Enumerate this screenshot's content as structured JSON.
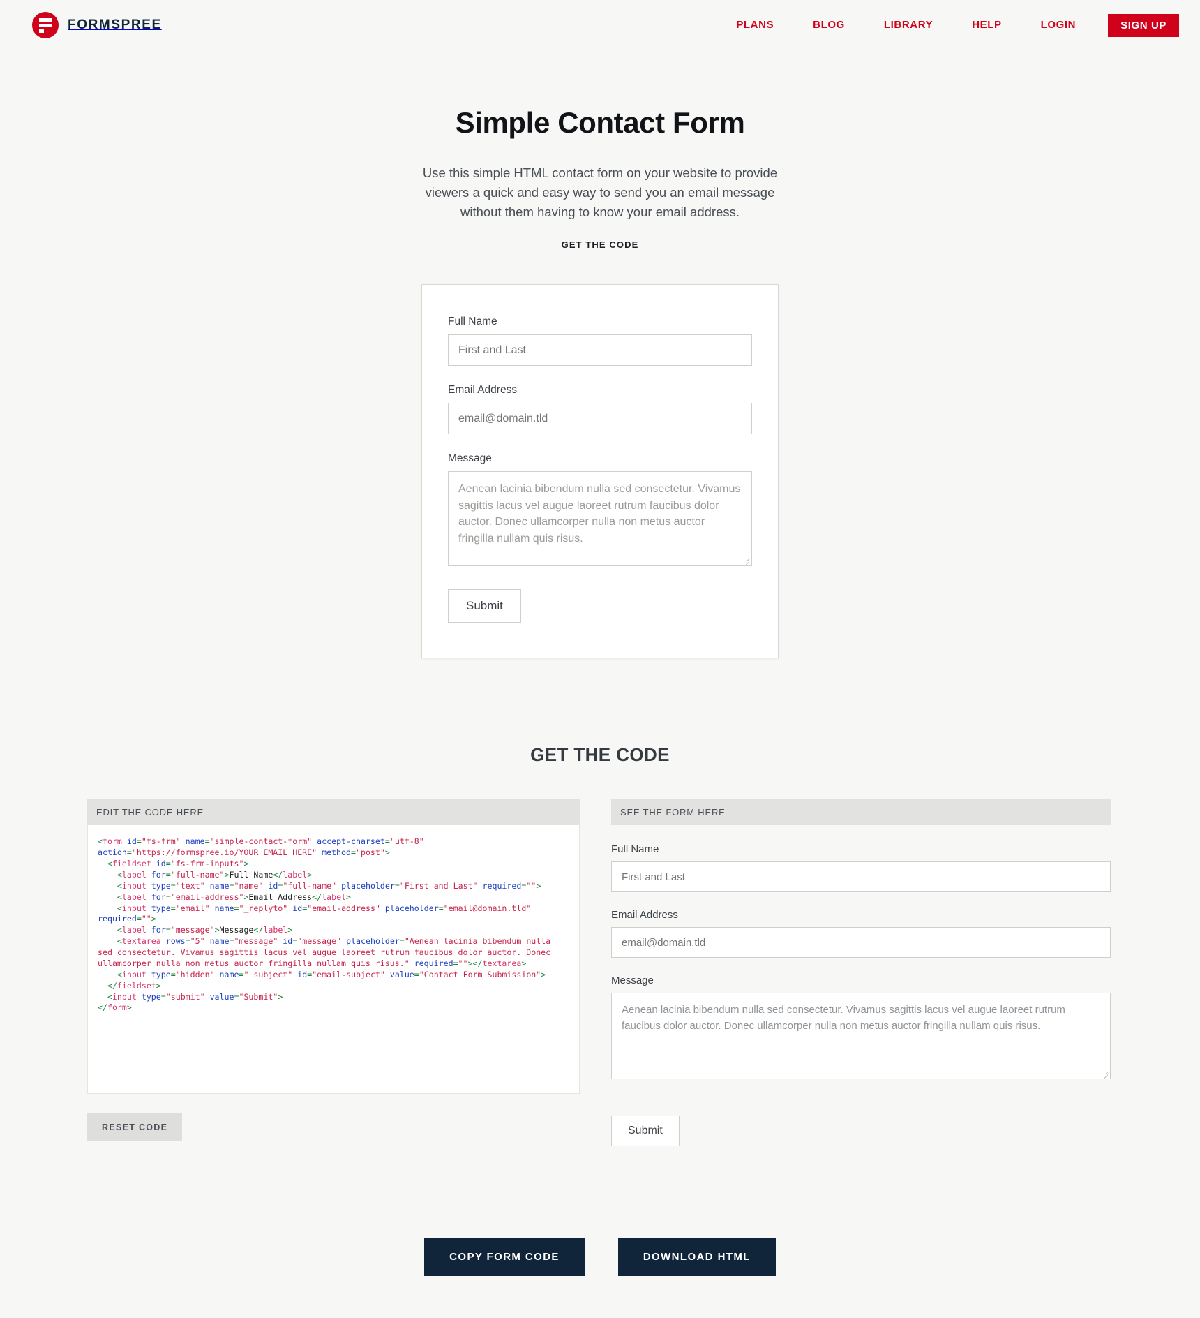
{
  "header": {
    "brand_name": "FORMSPREE",
    "nav": [
      {
        "label": "PLANS"
      },
      {
        "label": "BLOG"
      },
      {
        "label": "LIBRARY"
      },
      {
        "label": "HELP"
      },
      {
        "label": "LOGIN"
      }
    ],
    "signup_label": "SIGN UP",
    "brand_color": "#d0021b"
  },
  "hero": {
    "title": "Simple Contact Form",
    "description": "Use this simple HTML contact form on your website to provide viewers a quick and easy way to send you an email message without them having to know your email address.",
    "anchor_label": "GET THE CODE"
  },
  "demo_form": {
    "name_label": "Full Name",
    "name_placeholder": "First and Last",
    "email_label": "Email Address",
    "email_placeholder": "email@domain.tld",
    "message_label": "Message",
    "message_placeholder": "Aenean lacinia bibendum nulla sed consectetur. Vivamus sagittis lacus vel augue laoreet rutrum faucibus dolor auctor. Donec ullamcorper nulla non metus auctor fringilla nullam quis risus.",
    "submit_label": "Submit"
  },
  "code_section": {
    "heading": "GET THE CODE",
    "left_panel_title": "EDIT THE CODE HERE",
    "right_panel_title": "SEE THE FORM HERE",
    "reset_label": "RESET CODE",
    "code_text": "<form id=\"fs-frm\" name=\"simple-contact-form\" accept-charset=\"utf-8\" action=\"https://formspree.io/YOUR_EMAIL_HERE\" method=\"post\">\n  <fieldset id=\"fs-frm-inputs\">\n    <label for=\"full-name\">Full Name</label>\n    <input type=\"text\" name=\"name\" id=\"full-name\" placeholder=\"First and Last\" required=\"\">\n    <label for=\"email-address\">Email Address</label>\n    <input type=\"email\" name=\"_replyto\" id=\"email-address\" placeholder=\"email@domain.tld\" required=\"\">\n    <label for=\"message\">Message</label>\n    <textarea rows=\"5\" name=\"message\" id=\"message\" placeholder=\"Aenean lacinia bibendum nulla sed consectetur. Vivamus sagittis lacus vel augue laoreet rutrum faucibus dolor auctor. Donec ullamcorper nulla non metus auctor fringilla nullam quis risus.\" required=\"\"></textarea>\n    <input type=\"hidden\" name=\"_subject\" id=\"email-subject\" value=\"Contact Form Submission\">\n  </fieldset>\n  <input type=\"submit\" value=\"Submit\">\n</form>"
  },
  "preview_form": {
    "name_label": "Full Name",
    "name_placeholder": "First and Last",
    "email_label": "Email Address",
    "email_placeholder": "email@domain.tld",
    "message_label": "Message",
    "message_placeholder": "Aenean lacinia bibendum nulla sed consectetur. Vivamus sagittis lacus vel augue laoreet rutrum faucibus dolor auctor. Donec ullamcorper nulla non metus auctor fringilla nullam quis risus.",
    "submit_label": "Submit"
  },
  "footer_actions": {
    "copy_label": "COPY FORM CODE",
    "download_label": "DOWNLOAD HTML"
  }
}
